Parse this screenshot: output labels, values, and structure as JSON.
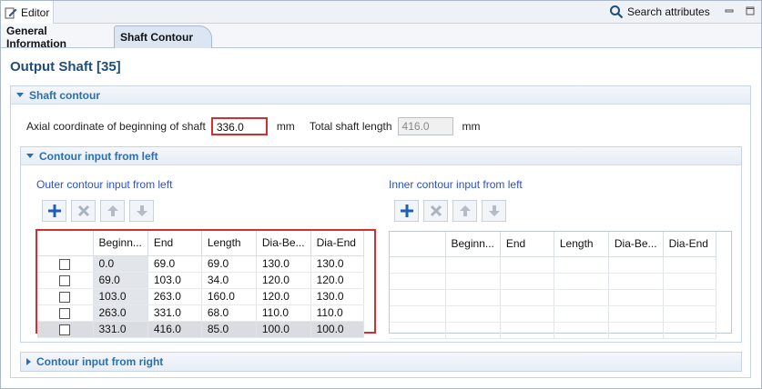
{
  "editor": {
    "tab_label": "Editor",
    "search_label": "Search attributes"
  },
  "tabs": [
    {
      "label": "General Information"
    },
    {
      "label": "Shaft Contour"
    }
  ],
  "page_title": "Output Shaft [35]",
  "shaft_contour": {
    "header": "Shaft contour",
    "axial_label": "Axial coordinate of beginning of shaft",
    "axial_value": "336.0",
    "axial_unit": "mm",
    "length_label": "Total shaft length",
    "length_value": "416.0",
    "length_unit": "mm"
  },
  "contour_left": {
    "header": "Contour input from left",
    "outer_title": "Outer contour input from left",
    "inner_title": "Inner contour input from left",
    "columns": [
      "Beginn...",
      "End",
      "Length",
      "Dia-Be...",
      "Dia-End"
    ],
    "outer_rows": [
      [
        "0.0",
        "69.0",
        "69.0",
        "130.0",
        "130.0"
      ],
      [
        "69.0",
        "103.0",
        "34.0",
        "120.0",
        "120.0"
      ],
      [
        "103.0",
        "263.0",
        "160.0",
        "120.0",
        "130.0"
      ],
      [
        "263.0",
        "331.0",
        "68.0",
        "110.0",
        "110.0"
      ],
      [
        "331.0",
        "416.0",
        "85.0",
        "100.0",
        "100.0"
      ]
    ]
  },
  "contour_right": {
    "header": "Contour input from right"
  },
  "colors": {
    "accent": "#2a6fb0",
    "highlight": "#d32f2f",
    "title": "#1f4e79"
  }
}
